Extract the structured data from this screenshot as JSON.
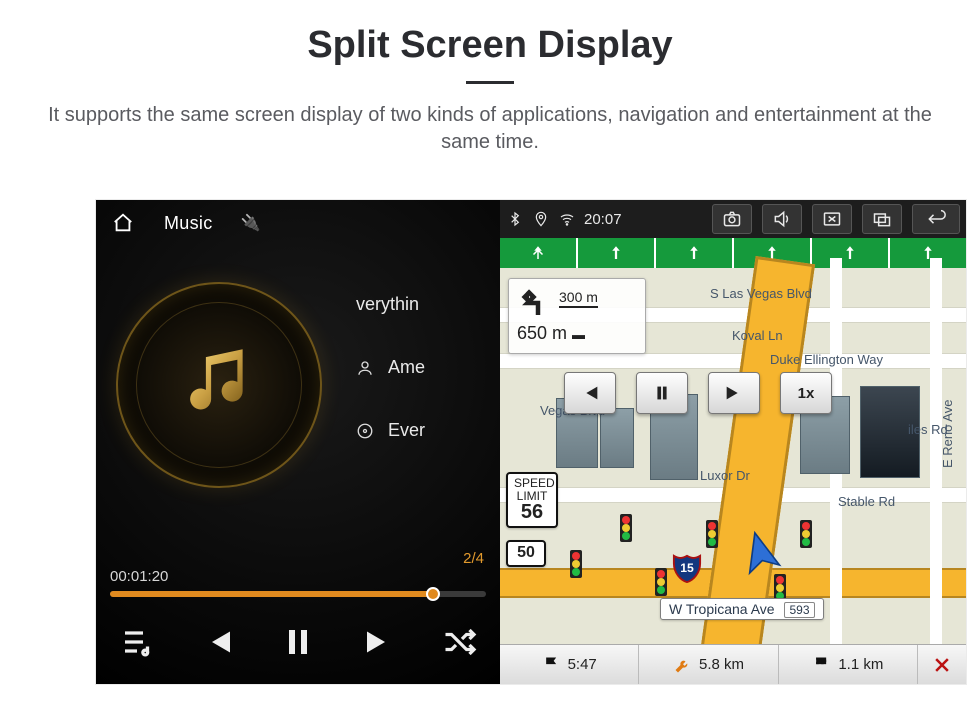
{
  "page": {
    "title": "Split Screen Display",
    "subtitle": "It supports the same screen display of two kinds of applications, navigation and entertainment at the same time."
  },
  "music": {
    "top_label": "Music",
    "track_title": "verythin",
    "artist": "Ame",
    "album": "Ever",
    "track_index": "2/4",
    "elapsed": "00:01:20",
    "progress_pct": 86
  },
  "statusbar": {
    "time": "20:07"
  },
  "nav": {
    "turn_dist_small": "300 m",
    "turn_dist_main": "650 m",
    "speed_limit_label": "SPEED LIMIT",
    "speed_limit_value": "56",
    "hwy_label": "50",
    "interstate": "15",
    "speed_btn": "1x",
    "streets": {
      "s_las_vegas": "S Las Vegas Blvd",
      "koval": "Koval Ln",
      "duke": "Duke Ellington Way",
      "luxor": "Luxor Dr",
      "stable": "Stable Rd",
      "reno": "E Reno Ave",
      "tropicana": "W Tropicana Ave",
      "trop_tag": "593",
      "iles": "iles Rd"
    },
    "bottom": {
      "eta": "5:47",
      "dist_main": "5.8 km",
      "dist_seg": "1.1 km"
    }
  }
}
